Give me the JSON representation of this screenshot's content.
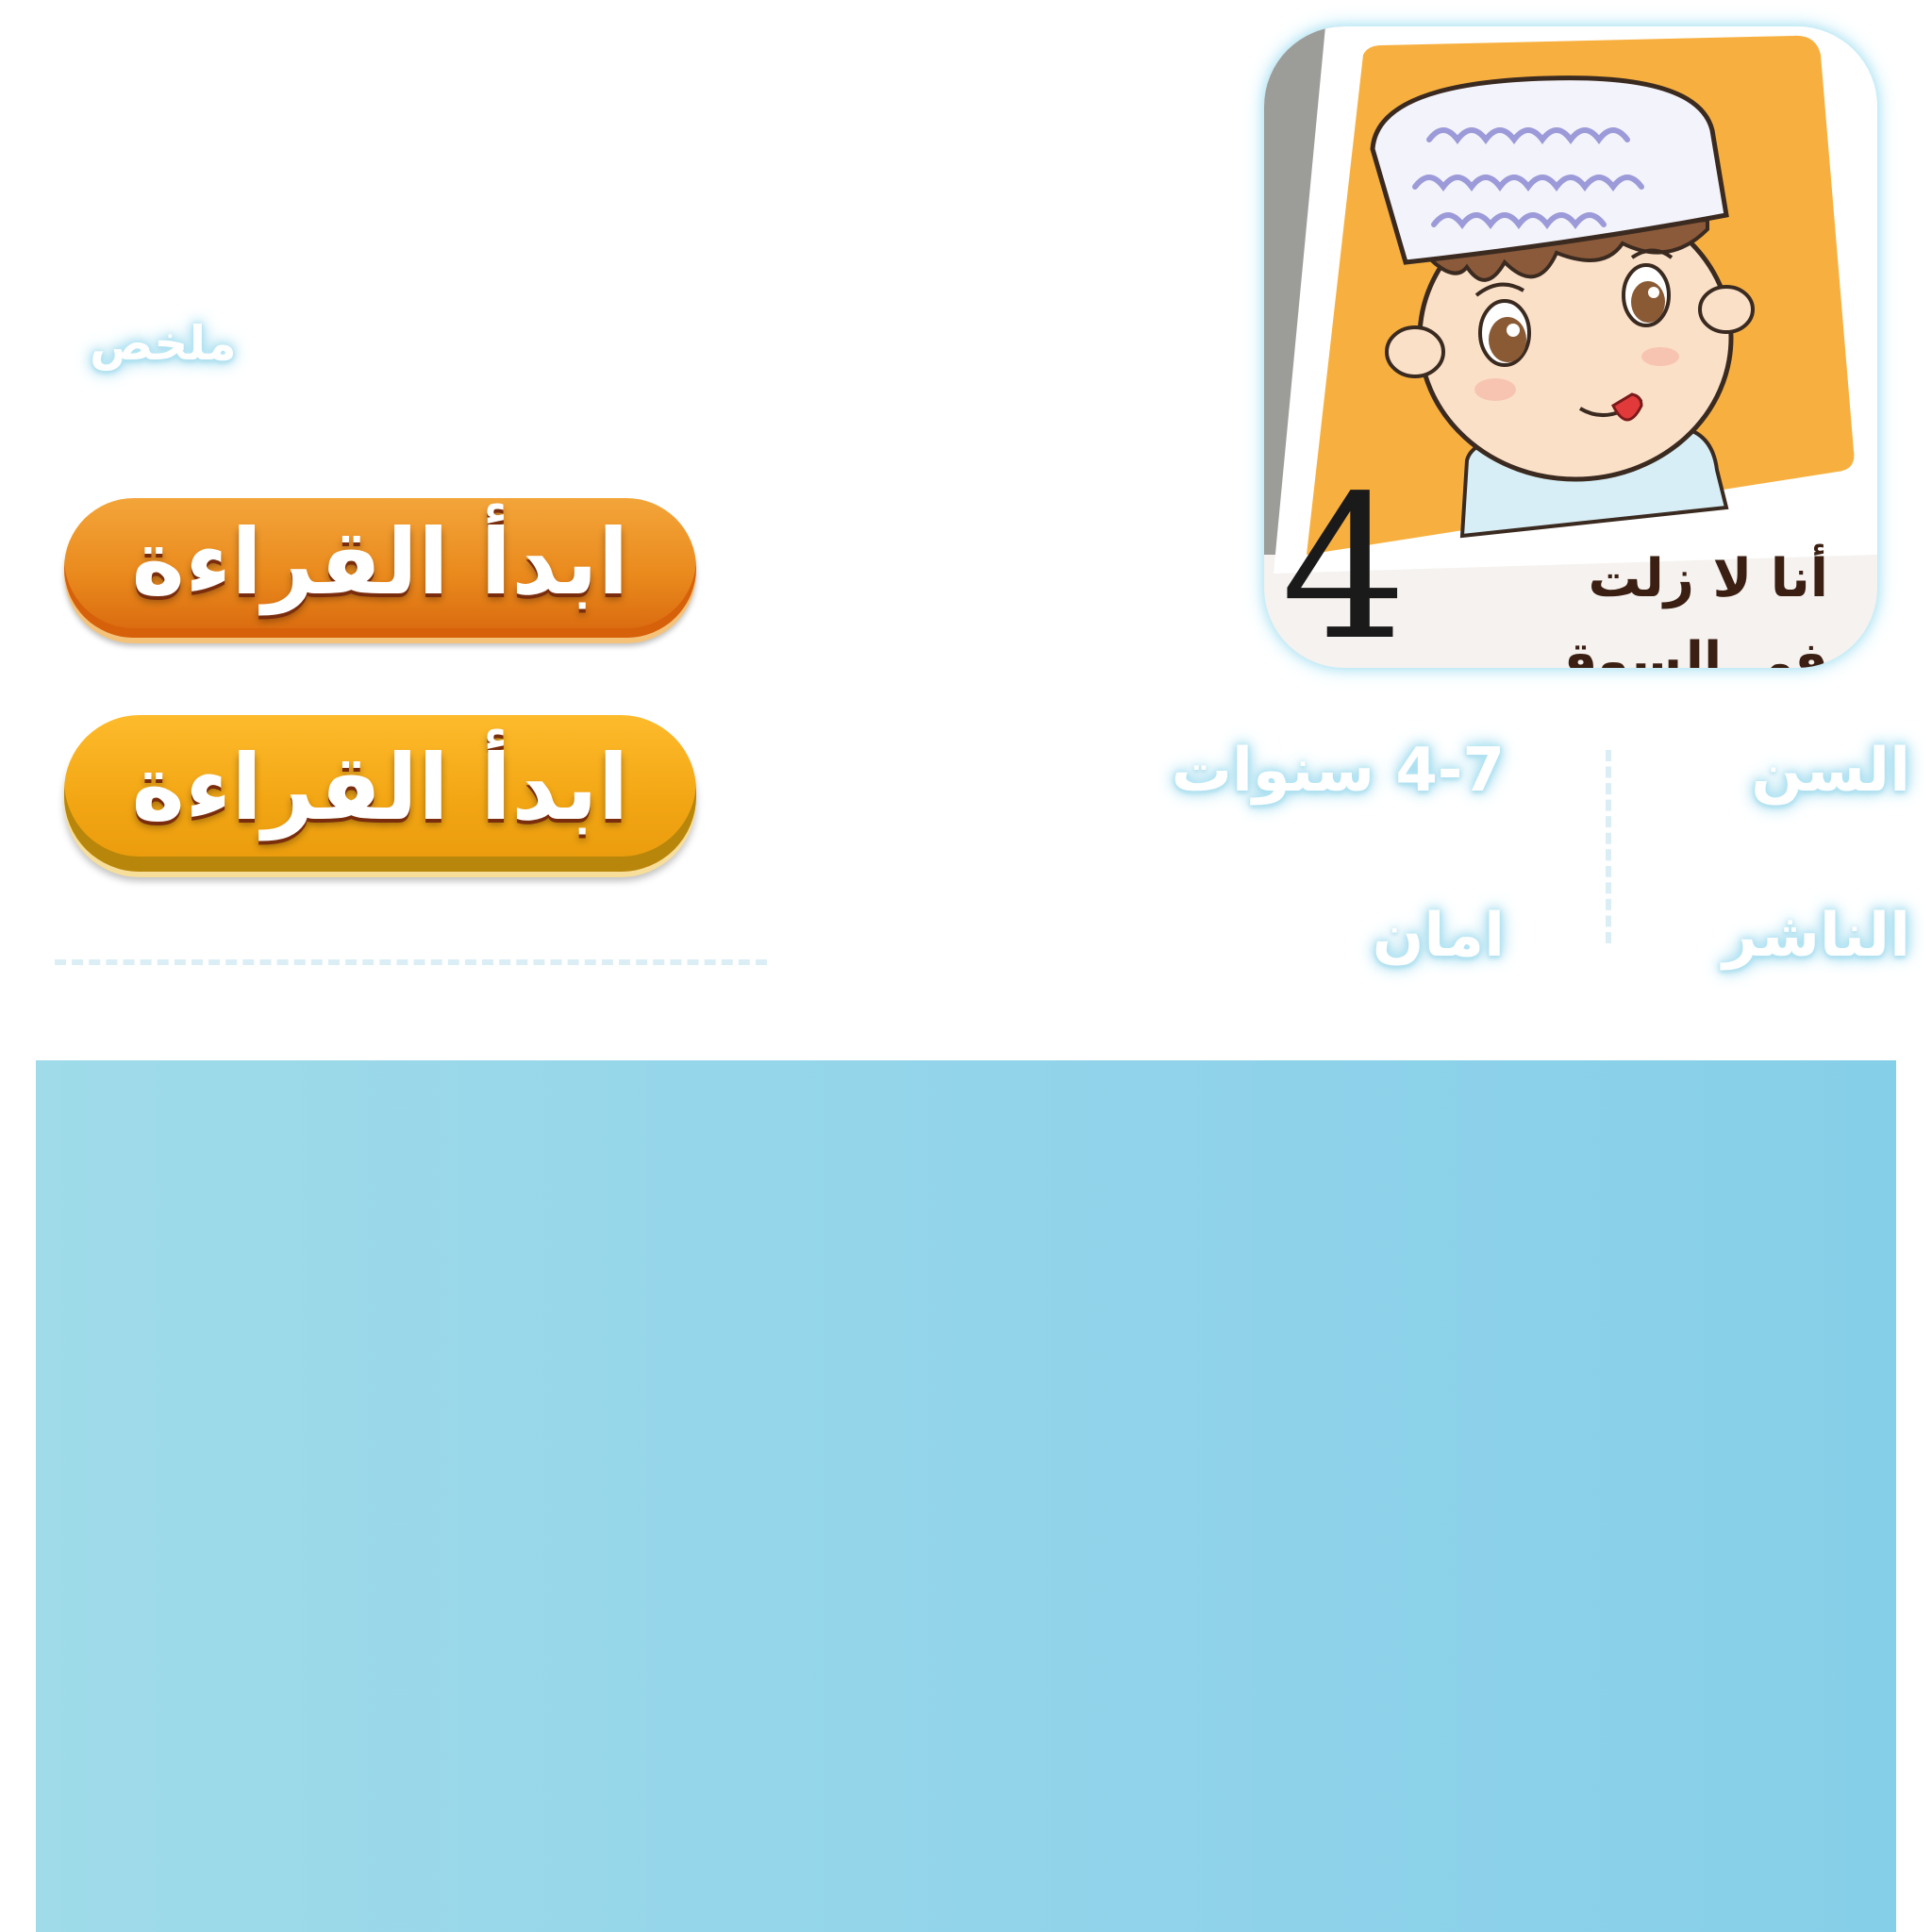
{
  "summary_label": "ملخص",
  "buttons": {
    "read_primary": "ابدأ القراءة",
    "read_secondary": "ابدأ القراءة"
  },
  "book": {
    "title_line1": "أنا لا زلت",
    "title_line2": "في السوق",
    "number": "4"
  },
  "meta": {
    "age_label": "السن",
    "age_value": "4-7 سنوات",
    "publisher_label": "الناشر",
    "publisher_value": "امان"
  },
  "colors": {
    "accent_glow": "#8fd3ea",
    "button_orange": "#ea8a1d",
    "button_gold": "#f3a614",
    "panel_blue": "#90d3ea",
    "cover_orange": "#f7b040"
  },
  "icons": {
    "cover_illustration": "boy-with-cap-illustration"
  }
}
